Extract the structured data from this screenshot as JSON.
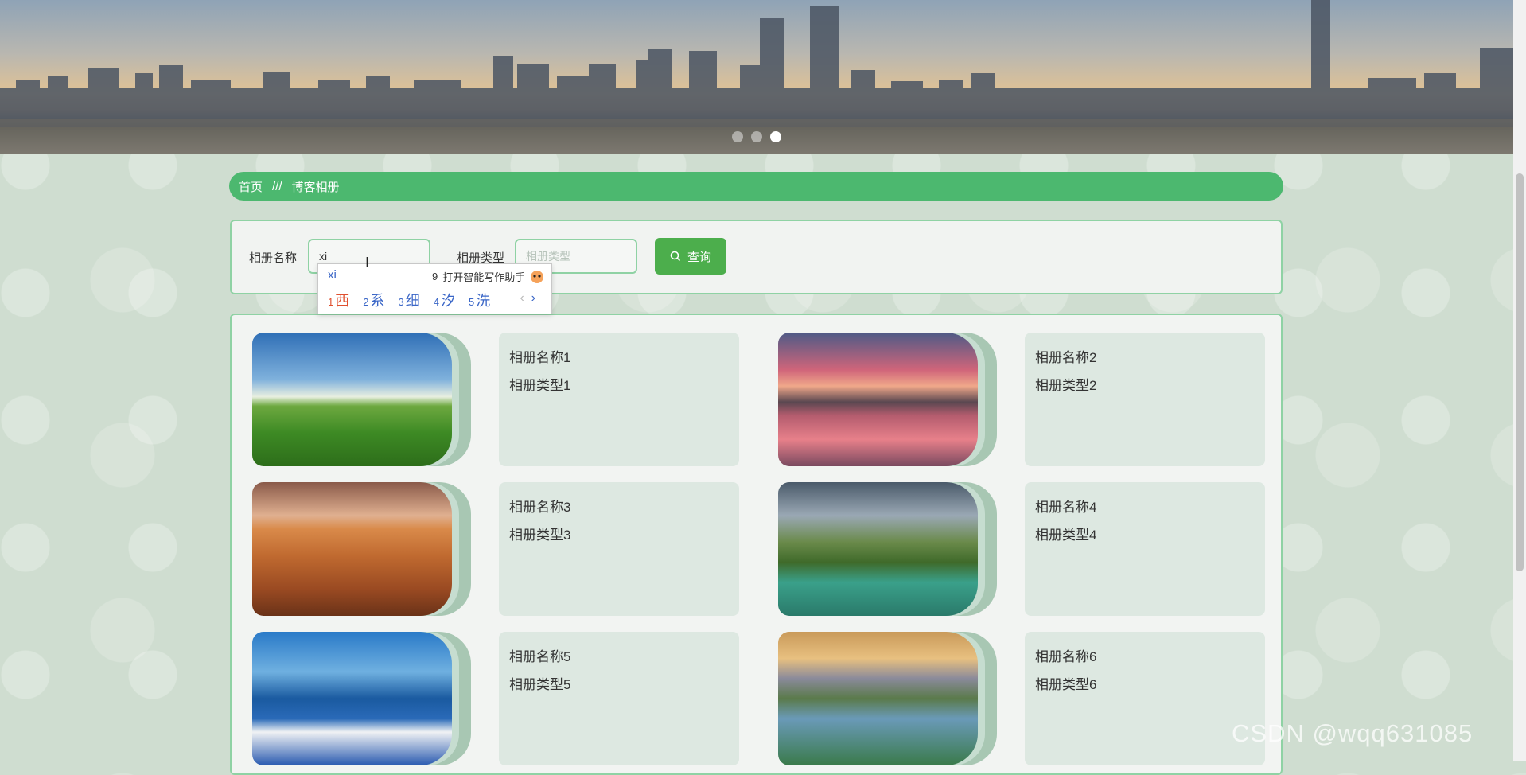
{
  "carousel": {
    "slide_count": 3,
    "active_index": 2
  },
  "breadcrumb": {
    "home": "首页",
    "separator": "///",
    "current": "博客相册"
  },
  "search": {
    "name_label": "相册名称",
    "name_value": "xi",
    "type_label": "相册类型",
    "type_placeholder": "相册类型",
    "query_button": "查询"
  },
  "ime": {
    "pinyin": "xi",
    "assistant_num": "9",
    "assistant_text": "打开智能写作助手",
    "candidates": [
      {
        "num": "1",
        "char": "西"
      },
      {
        "num": "2",
        "char": "系"
      },
      {
        "num": "3",
        "char": "细"
      },
      {
        "num": "4",
        "char": "汐"
      },
      {
        "num": "5",
        "char": "洗"
      }
    ],
    "prev": "‹",
    "next": "›"
  },
  "albums": [
    {
      "name": "相册名称1",
      "type": "相册类型1",
      "scene": "golf-course"
    },
    {
      "name": "相册名称2",
      "type": "相册类型2",
      "scene": "sunset-lake"
    },
    {
      "name": "相册名称3",
      "type": "相册类型3",
      "scene": "desert"
    },
    {
      "name": "相册名称4",
      "type": "相册类型4",
      "scene": "river-forest"
    },
    {
      "name": "相册名称5",
      "type": "相册类型5",
      "scene": "santorini"
    },
    {
      "name": "相册名称6",
      "type": "相册类型6",
      "scene": "mountain-lake"
    }
  ],
  "watermark": "CSDN @wqq631085",
  "colors": {
    "accent": "#4cb86f",
    "border": "#8fd2a4",
    "button": "#4cae4c"
  }
}
